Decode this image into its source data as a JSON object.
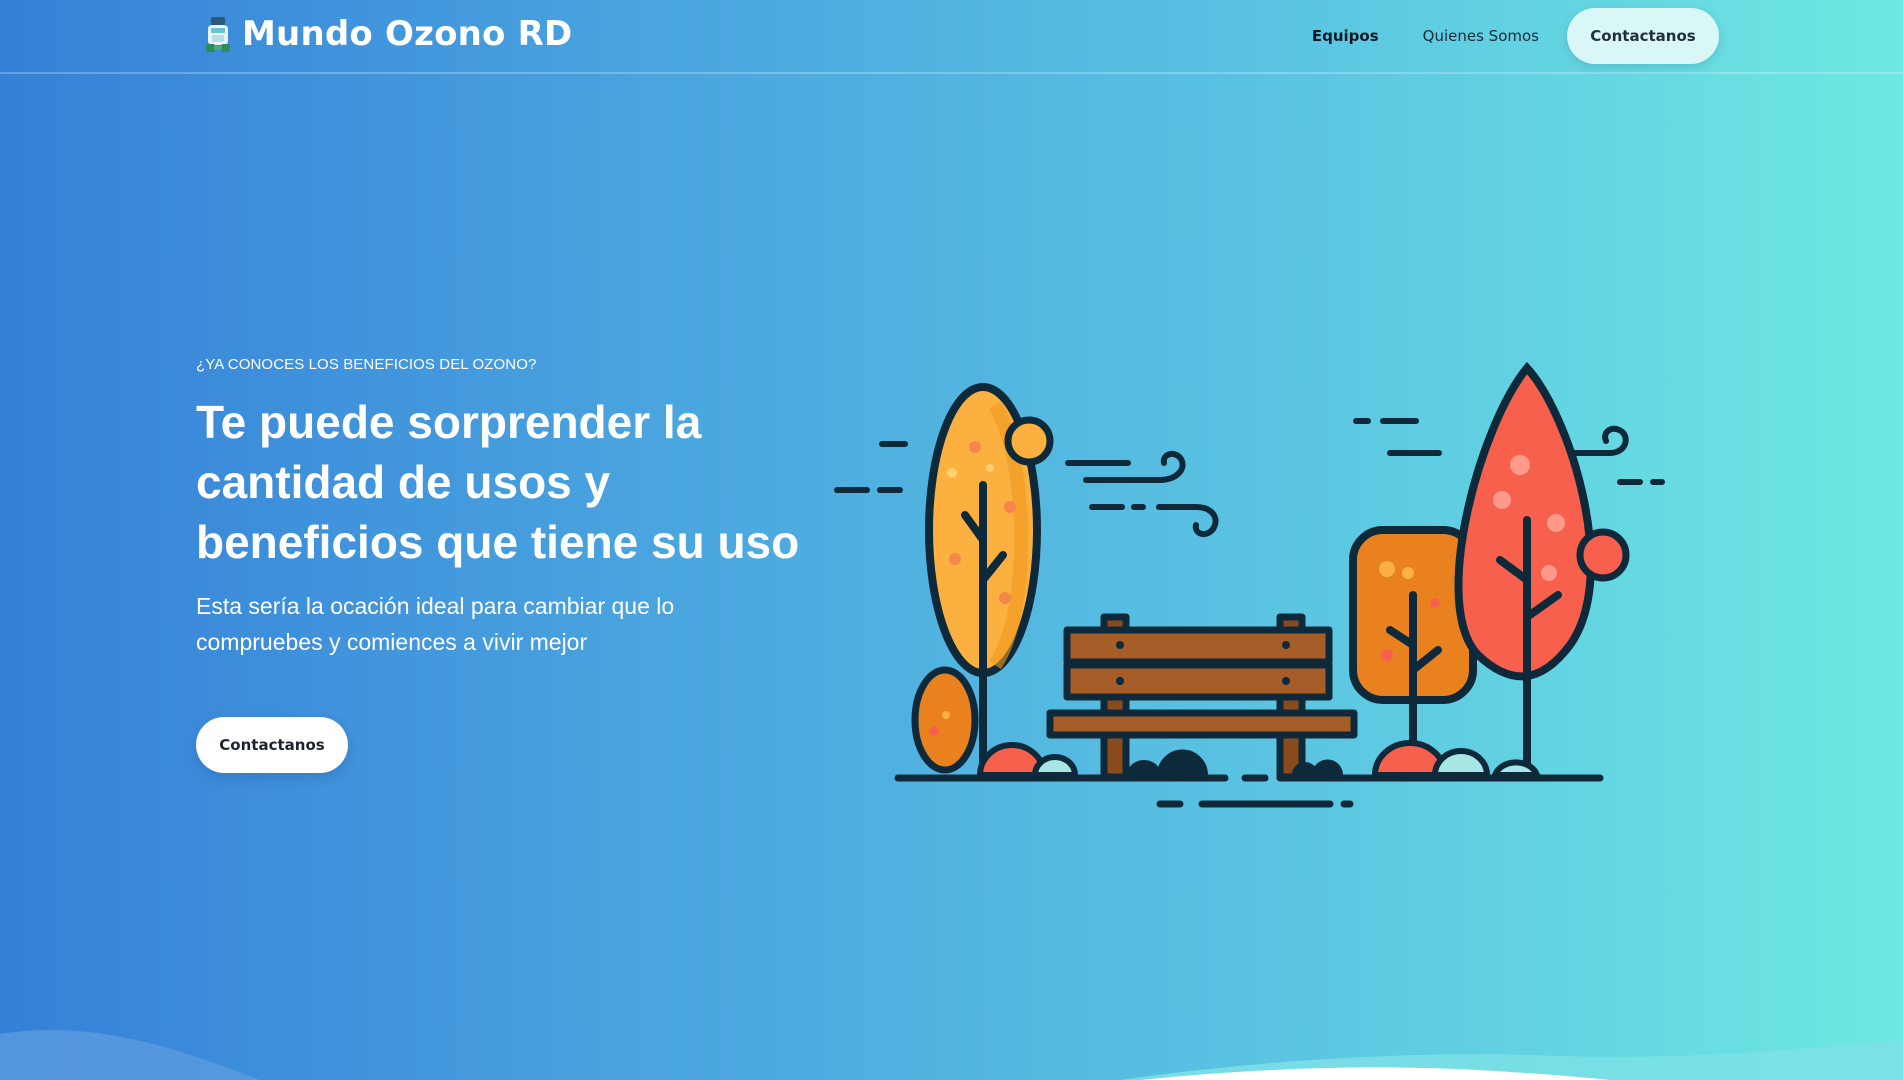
{
  "nav": {
    "brand": "Mundo Ozono RD",
    "links": [
      "Equipos",
      "Quienes Somos"
    ],
    "cta": "Contactanos"
  },
  "hero": {
    "eyebrow": "¿YA CONOCES LOS BENEFICIOS DEL OZONO?",
    "title": "Te puede sorprender la cantidad de usos y beneficios que tiene su uso",
    "subtitle": "Esta sería la ocación ideal para cambiar que lo compruebes y comiences a vivir mejor",
    "cta": "Contactanos"
  },
  "colors": {
    "gradient_start": "#3580d8",
    "gradient_end": "#6ee8e2",
    "tree_yellow": "#fbb040",
    "tree_orange": "#e9821e",
    "tree_red": "#f7604d",
    "bench_brown": "#8a4b1c",
    "outline": "#0e2a3a"
  },
  "icons": {
    "brand_logo": "ozone-generator-icon"
  }
}
